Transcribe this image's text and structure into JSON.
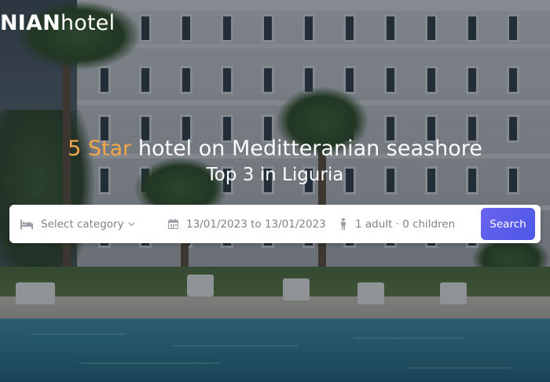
{
  "brand": {
    "bold": "NIAN",
    "light": "hotel"
  },
  "hero": {
    "accent": "5 Star",
    "title_rest": " hotel on Meditteranian seashore",
    "subtitle": "Top 3 in Liguria"
  },
  "search": {
    "category_placeholder": "Select category",
    "dates": "13/01/2023 to 13/01/2023",
    "guests": "1 adult · 0 children",
    "button_label": "Search"
  },
  "colors": {
    "accent_orange": "#f4a64d",
    "button_blue": "#5a5ded",
    "field_text": "#7d838a"
  },
  "icons": {
    "category": "bed-icon",
    "chevron": "chevron-down-icon",
    "dates": "calendar-icon",
    "guests": "person-icon"
  }
}
